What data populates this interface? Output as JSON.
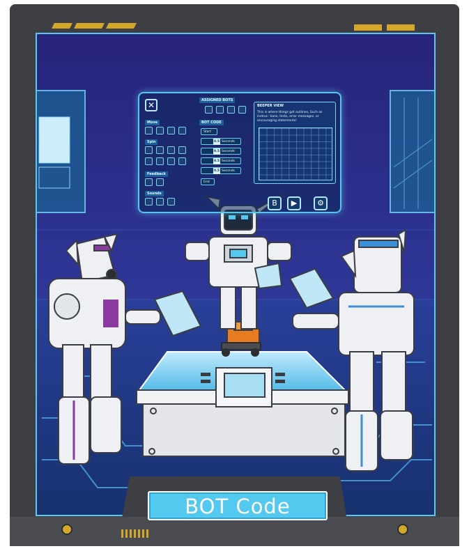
{
  "title": "BOT Code",
  "colors": {
    "frame_dark": "#3d3f44",
    "frame_mid": "#5c5f66",
    "screen_bg": "#2a2f8a",
    "accent_cyan": "#54c9ef",
    "holo_blue": "#57c6ef",
    "gold": "#d4a62a",
    "robot_white": "#eef0f3",
    "purple_accent": "#8b3aa0",
    "blue_accent": "#3d8fd6",
    "bot_orange": "#e87a1f"
  },
  "panel": {
    "assigned_bots": "ASSIGNED BOTS",
    "bot_code": "BOT CODE",
    "beeper_view": "BEEPER VIEW",
    "start": "Start",
    "end": "End",
    "move": "Move",
    "spin": "Spin",
    "feedback": "Feedback",
    "sounds": "Sounds",
    "preview_text": "This is where things get outlines, Such as instruc- tions, hints, error messages, or encouraging statements!",
    "rows": [
      {
        "value": "0.5",
        "unit": "Seconds"
      },
      {
        "value": "0.5",
        "unit": "Seconds"
      },
      {
        "value": "0.5",
        "unit": "Seconds"
      },
      {
        "value": "0.5",
        "unit": "Seconds"
      }
    ]
  },
  "icons": {
    "close": "close-icon",
    "play": "play-icon",
    "back": "back-icon",
    "settings": "robot-icon"
  }
}
